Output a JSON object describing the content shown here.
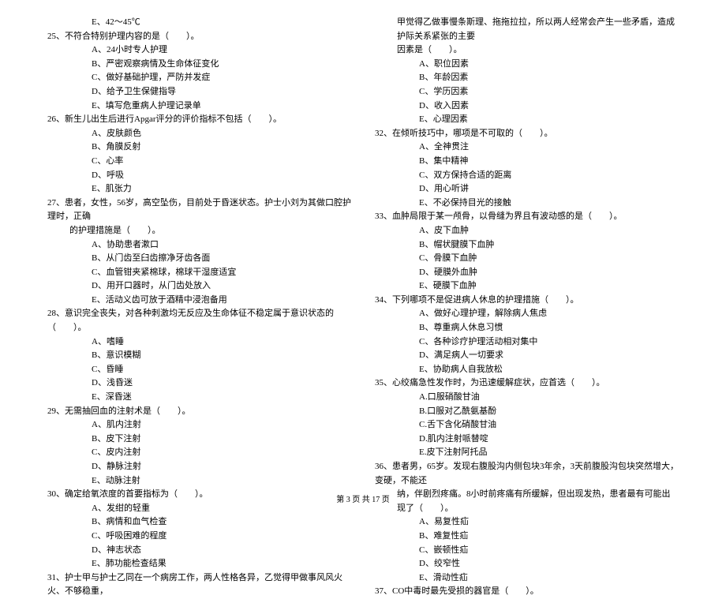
{
  "footer": "第 3 页 共 17 页",
  "left": {
    "firstOpt": "E、42～45℃",
    "q25": {
      "stem": "25、不符合特别护理内容的是（　　）。",
      "a": "A、24小时专人护理",
      "b": "B、严密观察病情及生命体征变化",
      "c": "C、做好基础护理，严防并发症",
      "d": "D、给予卫生保健指导",
      "e": "E、填写危重病人护理记录单"
    },
    "q26": {
      "stem": "26、新生儿出生后进行Apgar评分的评价指标不包括（　　）。",
      "a": "A、皮肤颜色",
      "b": "B、角膜反射",
      "c": "C、心率",
      "d": "D、呼吸",
      "e": "E、肌张力"
    },
    "q27": {
      "stem": "27、患者，女性，56岁，高空坠伤，目前处于昏迷状态。护士小刘为其做口腔护理时，正确",
      "stem2": "的护理措施是（　　）。",
      "a": "A、协助患者漱口",
      "b": "B、从门齿至臼齿擦净牙齿各面",
      "c": "C、血管钳夹紧棉球，棉球干湿度适宜",
      "d": "D、用开口器时，从门齿处放入",
      "e": "E、活动义齿可放于酒精中浸泡备用"
    },
    "q28": {
      "stem": "28、意识完全丧失，对各种刺激均无反应及生命体征不稳定属于意识状态的（　　）。",
      "a": "A、嗜睡",
      "b": "B、意识模糊",
      "c": "C、昏睡",
      "d": "D、浅昏迷",
      "e": "E、深昏迷"
    },
    "q29": {
      "stem": "29、无需抽回血的注射术是（　　）。",
      "a": "A、肌内注射",
      "b": "B、皮下注射",
      "c": "C、皮内注射",
      "d": "D、静脉注射",
      "e": "E、动脉注射"
    },
    "q30": {
      "stem": "30、确定给氧浓度的首要指标为（　　）。",
      "a": "A、发绀的轻重",
      "b": "B、病情和血气检查",
      "c": "C、呼吸困难的程度",
      "d": "D、神志状态",
      "e": "E、肺功能检查结果"
    },
    "q31": {
      "stem": "31、护士甲与护士乙同在一个病房工作，两人性格各异，乙觉得甲做事风风火火、不够稳重，"
    }
  },
  "right": {
    "q31cont1": "甲觉得乙做事慢条斯理、拖拖拉拉，所以两人经常会产生一些矛盾，造成护际关系紧张的主要",
    "q31cont2": "因素是（　　）。",
    "q31": {
      "a": "A、职位因素",
      "b": "B、年龄因素",
      "c": "C、学历因素",
      "d": "D、收入因素",
      "e": "E、心理因素"
    },
    "q32": {
      "stem": "32、在倾听技巧中，哪项是不可取的（　　）。",
      "a": "A、全神贯注",
      "b": "B、集中精神",
      "c": "C、双方保持合适的距离",
      "d": "D、用心听讲",
      "e": "E、不必保持目光的接触"
    },
    "q33": {
      "stem": "33、血肿局限于某一颅骨，以骨缝为界且有波动感的是（　　）。",
      "a": "A、皮下血肿",
      "b": "B、帽状腱膜下血肿",
      "c": "C、骨膜下血肿",
      "d": "D、硬膜外血肿",
      "e": "E、硬膜下血肿"
    },
    "q34": {
      "stem": "34、下列哪项不是促进病人休息的护理措施（　　）。",
      "a": "A、做好心理护理，解除病人焦虑",
      "b": "B、尊重病人休息习惯",
      "c": "C、各种诊疗护理活动相对集中",
      "d": "D、满足病人一切要求",
      "e": "E、协助病人自我放松"
    },
    "q35": {
      "stem": "35、心绞痛急性发作时，为迅速缓解症状，应首选（　　）。",
      "a": "A.口服硝酸甘油",
      "b": "B.口服对乙酰氨基酚",
      "c": "C.舌下含化硝酸甘油",
      "d": "D.肌内注射哌替啶",
      "e": "E.皮下注射阿托品"
    },
    "q36": {
      "stem": "36、患者男，65岁。发现右腹股沟内侧包块3年余，3天前腹股沟包块突然增大，变硬，不能还",
      "stem2": "纳，伴剧烈疼痛。8小时前疼痛有所缓解，但出现发热，患者最有可能出现了（　　）。",
      "a": "A、易复性疝",
      "b": "B、难复性疝",
      "c": "C、嵌顿性疝",
      "d": "D、绞窄性",
      "e": "E、滑动性疝"
    },
    "q37": {
      "stem": "37、CO中毒时最先受损的器官是（　　）。"
    }
  }
}
